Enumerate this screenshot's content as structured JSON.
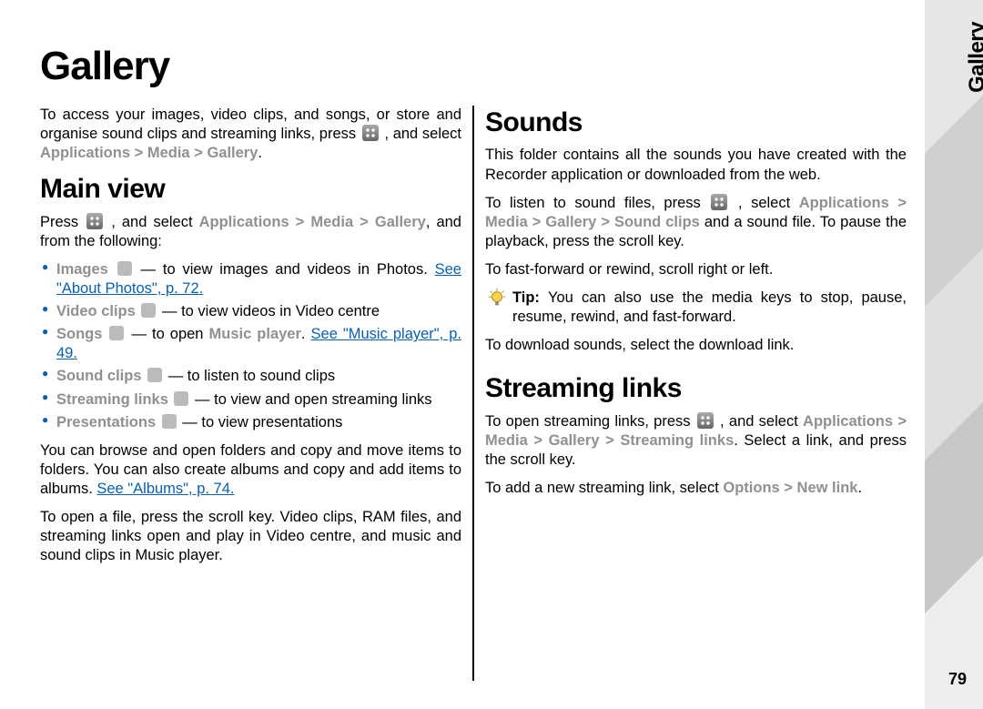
{
  "page_number": "79",
  "side_tab": "Gallery",
  "h1": "Gallery",
  "intro": {
    "pre": "To access your images, video clips, and songs, or store and organise sound clips and streaming links, press ",
    "post": " , and select ",
    "path1": "Applications",
    "sep": ">",
    "path2": "Media",
    "path3": "Gallery",
    "end": "."
  },
  "mainview": {
    "h2": "Main view",
    "lead_pre": "Press ",
    "lead_mid": " , and select ",
    "p1": "Applications",
    "p2": "Media",
    "p3": "Gallery",
    "lead_end": ", and from the following:",
    "items": {
      "images_lbl": "Images",
      "images_txt": " — to view images and videos in Photos. ",
      "images_link": "See \"About Photos\", p. 72.",
      "video_lbl": "Video clips",
      "video_txt": " — to view videos in Video centre",
      "songs_lbl": "Songs",
      "songs_txt": " — to open ",
      "songs_bold": "Music player",
      "songs_dot": ". ",
      "songs_link": "See \"Music player\", p. 49.",
      "sound_lbl": "Sound clips",
      "sound_txt": " — to listen to sound clips",
      "stream_lbl": "Streaming links",
      "stream_txt": " — to view and open streaming links",
      "pres_lbl": "Presentations",
      "pres_txt": " — to view presentations"
    },
    "browse": "You can browse and open folders and copy and move items to folders. You can also create albums and copy and add items to albums. ",
    "browse_link": "See \"Albums\", p. 74.",
    "open": "To open a file, press the scroll key. Video clips, RAM files, and streaming links open and play in Video centre, and music and sound clips in Music player."
  },
  "sounds": {
    "h2": "Sounds",
    "p1": "This folder contains all the sounds you have created with the Recorder application or downloaded from the web.",
    "listen_pre": "To listen to sound files, press ",
    "listen_mid": " , select ",
    "a": "Applications",
    "m": "Media",
    "g": "Gallery",
    "sc": "Sound clips",
    "listen_end": " and a sound file. To pause the playback, press the scroll key.",
    "ff": "To fast-forward or rewind, scroll right or left.",
    "tip_lbl": "Tip: ",
    "tip_txt": " You can also use the media keys to stop, pause, resume, rewind, and fast-forward.",
    "dl": "To download sounds, select the download link."
  },
  "stream": {
    "h2": "Streaming links",
    "open_pre": "To open streaming links, press ",
    "open_mid": " , and select ",
    "a": "Applications",
    "m": "Media",
    "g": "Gallery",
    "sl": "Streaming links",
    "open_end": ". Select a link, and press the scroll key.",
    "add_pre": "To add a new streaming link, select ",
    "opt": "Options",
    "nl": "New link",
    "add_end": "."
  }
}
